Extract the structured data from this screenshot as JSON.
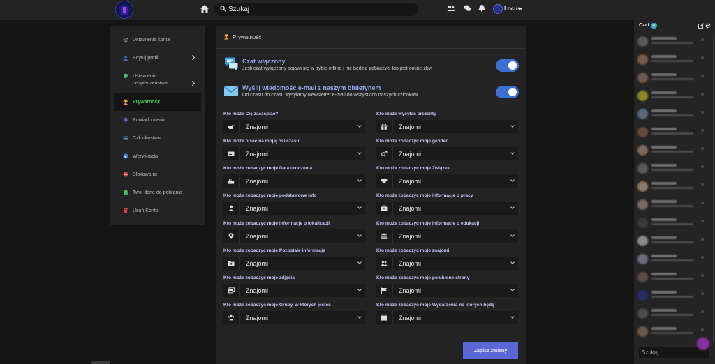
{
  "header": {
    "search_placeholder": "Szukaj",
    "user_name": "Locus"
  },
  "sidebar": {
    "items": [
      {
        "label": "Ustawienia konta",
        "icon": "gear-icon",
        "color": "#9a9a9a"
      },
      {
        "label": "Edytuj profil",
        "icon": "user-icon",
        "color": "#3f6fd8",
        "chevron": true
      },
      {
        "label_line1": "Ustawienia",
        "label_line2": "bezpieczeństwa",
        "icon": "shield-icon",
        "color": "#3fbf6f",
        "chevron": true
      },
      {
        "label": "Prywatność",
        "icon": "user-secret-icon",
        "color": "#f0a030",
        "active": true
      },
      {
        "label": "Powiadomienia",
        "icon": "bell-icon",
        "color": "#7a4fd8"
      },
      {
        "label": "Członkostwo",
        "icon": "card-icon",
        "color": "#3fa0a0"
      },
      {
        "label": "Weryfikacja",
        "icon": "check-circle-icon",
        "color": "#3f7fd8"
      },
      {
        "label": "Blokowanie",
        "icon": "block-icon",
        "color": "#e04040"
      },
      {
        "label": "Twoi dane do pobrania",
        "icon": "file-icon",
        "color": "#3fbf5f"
      },
      {
        "label": "Usuń Konto",
        "icon": "trash-icon",
        "color": "#e04040"
      }
    ]
  },
  "panel": {
    "title": "Prywatność",
    "chat_toggle": {
      "title": "Czat włączony",
      "description": "Jeśli czat wyłączony pojawi się w trybie offline i nie będzie zobaczyć, kto jest online zbyt",
      "on": true
    },
    "newsletter_toggle": {
      "title": "Wyślij wiadomość e-mail z naszym biuletynem",
      "description": "Od czasu do czasu wysyłamy Newsletter e-mail do wszystkich naszych członków",
      "on": true
    },
    "fields": [
      {
        "label": "Kto może Cię zaczepiać?",
        "value": "Znajomi",
        "icon": "poke-hand-icon"
      },
      {
        "label": "Kto może wysyłać prezenty",
        "value": "Znajomi",
        "icon": "gift-icon"
      },
      {
        "label": "Kto może pisać na mojej osi czasu",
        "value": "Znajomi",
        "icon": "id-card-icon"
      },
      {
        "label": "Kto może zobaczyć moje gender",
        "value": "Znajomi",
        "icon": "gender-icon"
      },
      {
        "label": "Kto może zobaczyć moje Data urodzenia",
        "value": "Znajomi",
        "icon": "birthday-cake-icon"
      },
      {
        "label": "Kto może zobaczyć moje Związek",
        "value": "Znajomi",
        "icon": "heart-icon"
      },
      {
        "label": "Kto może zobaczyć moje podstawowe info",
        "value": "Znajomi",
        "icon": "user-icon"
      },
      {
        "label": "Kto może zobaczyć moje informacje o pracy",
        "value": "Znajomi",
        "icon": "briefcase-icon"
      },
      {
        "label": "Kto może zobaczyć moje informacje o lokalizacji",
        "value": "Znajomi",
        "icon": "map-pin-icon"
      },
      {
        "label": "Kto może zobaczyć moje informacje o edukacji",
        "value": "Znajomi",
        "icon": "university-icon"
      },
      {
        "label": "Kto może zobaczyć moje Pozostałe informacje",
        "value": "Znajomi",
        "icon": "folder-icon"
      },
      {
        "label": "Kto może zobaczyć moje znajomi",
        "value": "Znajomi",
        "icon": "users-icon"
      },
      {
        "label": "Kto może zobaczyć moje zdjęcia",
        "value": "Znajomi",
        "icon": "images-icon"
      },
      {
        "label": "Kto może zobaczyć moje polubione strony",
        "value": "Znajomi",
        "icon": "flag-icon"
      },
      {
        "label": "Kto może zobaczyć moje Grupy, w których jesteś",
        "value": "Znajomi",
        "icon": "group-icon"
      },
      {
        "label": "Kto może zobaczyć moje Wydarzenia na których będę",
        "value": "Znajomi",
        "icon": "calendar-icon"
      }
    ],
    "save_label": "Zapisz zmiany"
  },
  "chat": {
    "title": "Czat",
    "count": "0",
    "search_placeholder": "Szukaj"
  },
  "colors": {
    "accent": "#5b67d6",
    "toggle": "#3c6fd1",
    "panel_bg": "#232323",
    "page_bg": "#141414"
  }
}
